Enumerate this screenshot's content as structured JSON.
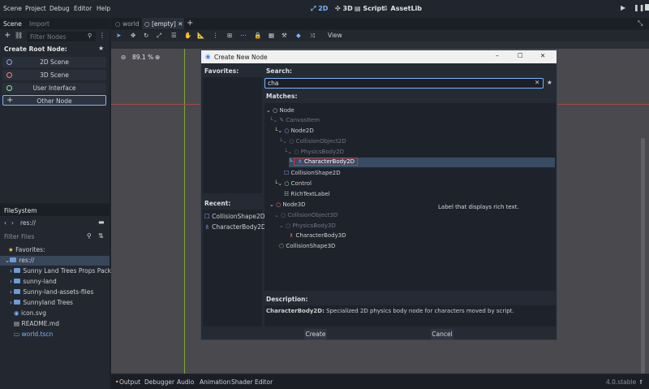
{
  "menubar": {
    "items": [
      "Scene",
      "Project",
      "Debug",
      "Editor",
      "Help"
    ],
    "workspaces": [
      "2D",
      "3D",
      "Script",
      "AssetLib"
    ]
  },
  "scene_dock": {
    "tabs": [
      "Scene",
      "Import"
    ],
    "filter_placeholder": "Filter Nodes",
    "create_root_label": "Create Root Node:",
    "roots": [
      {
        "label": "2D Scene",
        "color": "#8da5f3"
      },
      {
        "label": "3D Scene",
        "color": "#fc7f7f"
      },
      {
        "label": "User Interface",
        "color": "#8eef97"
      },
      {
        "label": "Other Node",
        "color": "#e0e0e0"
      }
    ]
  },
  "editor_tabs": {
    "tabs": [
      "world",
      "[empty]"
    ],
    "view_label": "View",
    "zoom": "89.1 %"
  },
  "filesystem": {
    "title": "FileSystem",
    "path": "res://",
    "filter_placeholder": "Filter Files",
    "items": [
      {
        "label": "Favorites:",
        "type": "fav"
      },
      {
        "label": "res://",
        "type": "root"
      },
      {
        "label": "Sunny Land Trees Props Pack",
        "type": "folder"
      },
      {
        "label": "sunny-land",
        "type": "folder"
      },
      {
        "label": "Sunny-land-assets-files",
        "type": "folder"
      },
      {
        "label": "Sunnyland Trees",
        "type": "folder"
      },
      {
        "label": "icon.svg",
        "type": "file"
      },
      {
        "label": "README.md",
        "type": "file"
      },
      {
        "label": "world.tscn",
        "type": "scene"
      }
    ]
  },
  "dialog": {
    "title": "Create New Node",
    "favorites_label": "Favorites:",
    "recent_label": "Recent:",
    "recent_items": [
      "CollisionShape2D",
      "CharacterBody2D"
    ],
    "search_label": "Search:",
    "search_value": "cha",
    "matches_label": "Matches:",
    "tree": [
      "Node",
      "CanvasItem",
      "Node2D",
      "CollisionObject2D",
      "PhysicsBody2D",
      "CharacterBody2D",
      "CollisionShape2D",
      "Control",
      "RichTextLabel",
      "Node3D",
      "CollisionObject3D",
      "PhysicsBody3D",
      "CharacterBody3D",
      "CollisionShape3D"
    ],
    "tooltip": "Label that displays rich text.",
    "description_label": "Description:",
    "description_name": "CharacterBody2D:",
    "description_text": " Specialized 2D physics body node for characters moved by script.",
    "create_button": "Create",
    "cancel_button": "Cancel"
  },
  "bottom": {
    "tabs": [
      "Output",
      "Debugger",
      "Audio",
      "Animation",
      "Shader Editor"
    ],
    "version": "4.0.stable"
  }
}
